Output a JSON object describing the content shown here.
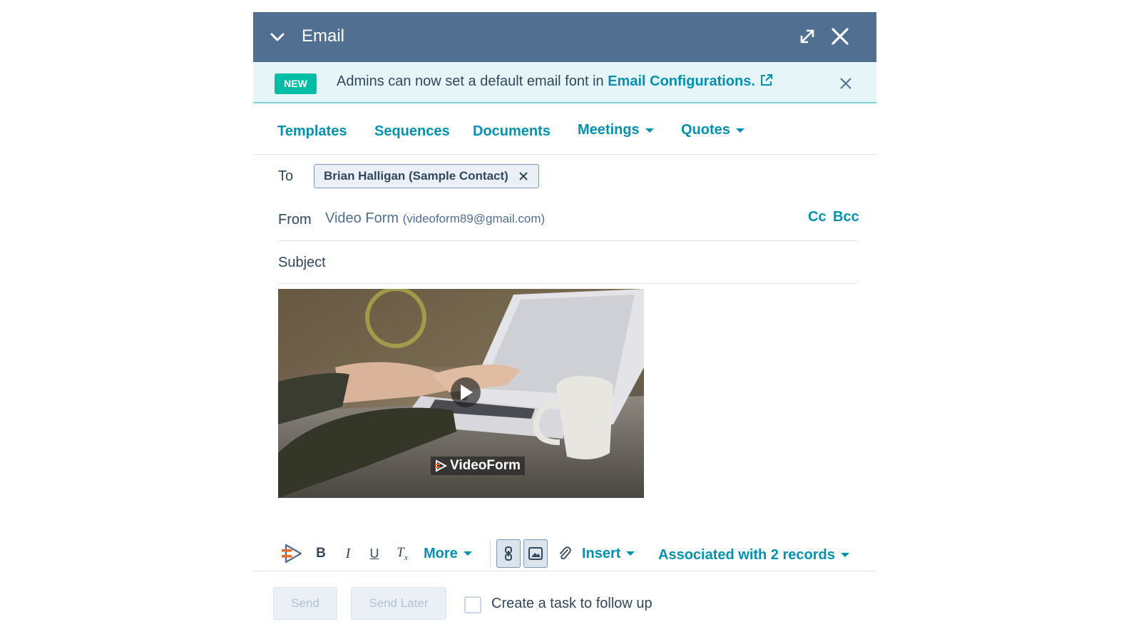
{
  "header": {
    "title": "Email"
  },
  "banner": {
    "badge": "NEW",
    "message": "Admins can now set a default email font in ",
    "link": "Email Configurations."
  },
  "tabs": [
    {
      "label": "Templates"
    },
    {
      "label": "Sequences"
    },
    {
      "label": "Documents"
    },
    {
      "label": "Meetings"
    },
    {
      "label": "Quotes"
    }
  ],
  "to": {
    "label": "To",
    "recipient": "Brian Halligan (Sample Contact)"
  },
  "from": {
    "label": "From",
    "name": "Video Form",
    "address": "(videoform89@gmail.com)",
    "cc": "Cc",
    "bcc": "Bcc"
  },
  "subject": {
    "label": "Subject",
    "value": ""
  },
  "video": {
    "watermark": "VideoForm"
  },
  "toolbar": {
    "more": "More",
    "insert": "Insert",
    "associated": "Associated with 2 records",
    "icons": [
      "videoform-logo-icon",
      "bold-icon",
      "italic-icon",
      "underline-icon",
      "clear-format-icon",
      "link-icon",
      "image-icon",
      "attachment-icon"
    ]
  },
  "footer": {
    "send": "Send",
    "send_later": "Send Later",
    "followup": "Create a task to follow up"
  },
  "colors": {
    "header": "#516f90",
    "accent": "#0091ae",
    "badge": "#00bda5",
    "banner": "#e5f5f8"
  }
}
